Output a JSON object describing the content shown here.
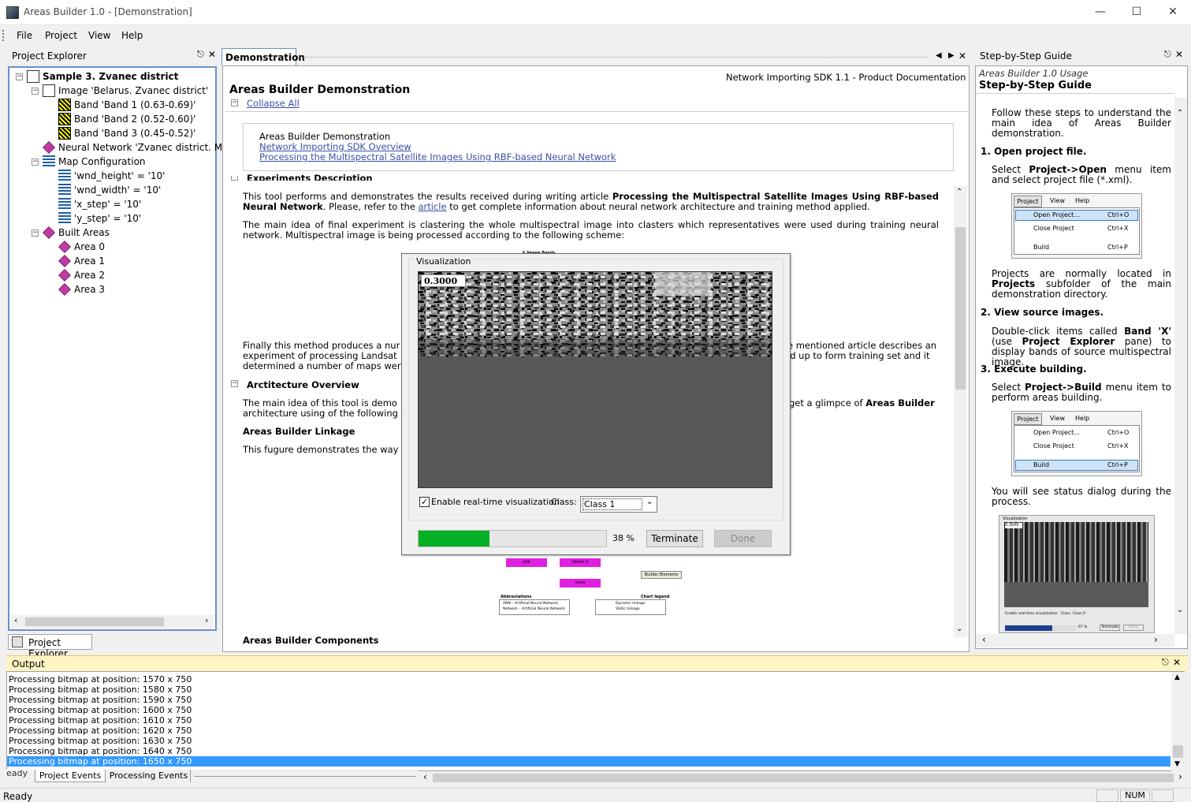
{
  "window": {
    "title": "Areas Builder 1.0 - [Demonstration]"
  },
  "menu": [
    "File",
    "Project",
    "View",
    "Help"
  ],
  "explorer": {
    "title": "Project Explorer",
    "tab_label": "Project Explorer",
    "items": [
      {
        "label": "Sample 3. Zvanec district",
        "icon": "project-icon"
      },
      {
        "label": "Image 'Belarus. Zvanec district'",
        "icon": "image-icon"
      },
      {
        "label": "Band 'Band 1 (0.63-0.69)'",
        "icon": "band-icon"
      },
      {
        "label": "Band 'Band 2 (0.52-0.60)'",
        "icon": "band-icon"
      },
      {
        "label": "Band 'Band 3 (0.45-0.52)'",
        "icon": "band-icon"
      },
      {
        "label": "Neural Network 'Zvanec district. Mult",
        "icon": "network-icon"
      },
      {
        "label": "Map Configuration",
        "icon": "map-icon"
      },
      {
        "label": "'wnd_height' = '10'",
        "icon": "variable-icon"
      },
      {
        "label": "'wnd_width' = '10'",
        "icon": "variable-icon"
      },
      {
        "label": "'x_step' = '10'",
        "icon": "variable-icon"
      },
      {
        "label": "'y_step' = '10'",
        "icon": "variable-icon"
      },
      {
        "label": "Built Areas",
        "icon": "areas-icon"
      },
      {
        "label": "Area 0",
        "icon": "area-icon"
      },
      {
        "label": "Area 1",
        "icon": "area-icon"
      },
      {
        "label": "Area 2",
        "icon": "area-icon"
      },
      {
        "label": "Area 3",
        "icon": "area-icon"
      }
    ]
  },
  "document": {
    "tab": "Demonstration",
    "header_right": "Network Importing SDK 1.1 - Product Documentation",
    "title": "Areas Builder Demonstration",
    "collapse": "Collapse All",
    "toc_title": "Areas Builder Demonstration",
    "toc_links": [
      "Network Importing SDK Overview",
      "Processing the Multispectral Satellite Images Using RBF-based Neural Network"
    ],
    "sec1": "Experiments Description",
    "p1a": "This tool performs and demonstrates the results received during writing article ",
    "p1b": "Processing the Multispectral Satellite Images Using RBF-based Neural Network",
    "p1c": ". Please, refer to the ",
    "p1link": "article",
    "p1d": " to get complete information about neural network architecture and training method applied.",
    "p2": "The main idea of final experiment is clastering the whole multispectral image into clasters which representatives were used during training neural network. Multispectral image is being processed according to the following scheme:",
    "p3l1a": "Finally this method produces a nur",
    "p3l1b": "e mentioned article describes an",
    "p3l2a": "experiment of processing Landsat",
    "p3l2b": "ld up to form training set and it",
    "p3l3": "determined a number of maps were",
    "sec2": "Arctitecture Overview",
    "p4l1a": "The main idea of this tool is demo",
    "p4l1b": "get a glimpce of ",
    "p4l1c": "Areas Builder",
    "p4l2": "architecture using of the following f",
    "sub1": "Areas Builder Linkage",
    "p5": "This fugure demonstrates the way t",
    "sub2": "Areas Builder Components"
  },
  "diagram": {
    "top_label": "k Image Bands",
    "boxes": [
      "stib",
      "hbsmt 3",
      "icons"
    ],
    "builder": "Builder Elements",
    "abbrev_title": "Abbreviations",
    "abbrev": [
      "ANN – Artificial Neural Network",
      "Network – Artificial Neural Network"
    ],
    "legend_title": "Chart legend",
    "legend": [
      "Dynamic linkage",
      "Static linkage"
    ]
  },
  "dialog": {
    "title": "Visualization",
    "value": "0.3000",
    "checkbox_label": "Enable real-time visualization",
    "checked": true,
    "class_label": "Class:",
    "class_value": "Class 1",
    "progress": 0.38,
    "progress_text": "38 %",
    "terminate": "Terminate",
    "done": "Done",
    "bar_color": "#06b025"
  },
  "guide": {
    "title": "Step-by-Step Guide",
    "subtitle": "Areas Builder 1.0 Usage",
    "heading": "Step-by-Step Guide",
    "intro": "Follow these steps to understand the main idea of Areas Builder demonstration.",
    "s1": "1. Open project file.",
    "s1a": "Select ",
    "s1b": "Project->Open",
    "s1c": " menu item and select project file (*.xml).",
    "menu1": {
      "tabs": [
        "Project",
        "View",
        "Help"
      ],
      "items": [
        [
          "Open Project...",
          "Ctrl+O"
        ],
        [
          "Close Project",
          "Ctrl+X"
        ],
        [
          "Build",
          "Ctrl+P"
        ]
      ]
    },
    "p2a": "Projects are normally located in ",
    "p2b": "Projects",
    "p2c": " subfolder of the main demonstration directory.",
    "s2": "2. View source images.",
    "s2a": "Double-click items called ",
    "s2b": "Band 'X'",
    "s2c": " (use ",
    "s2d": "Project Explorer",
    "s2e": " pane) to display bands of source multispectral image.",
    "s3": "3. Execute building.",
    "s3a": "Select ",
    "s3b": "Project->Build",
    "s3c": " menu item to perform areas building.",
    "p3": "You will see status dialog during the process.",
    "mini_vis": {
      "title": "Visualization",
      "value": "0.3000",
      "check": "Enable real-time visualization",
      "class_label": "Class:",
      "class": "Class 0",
      "pct": "67 %",
      "terminate": "Terminate",
      "done": "Done"
    }
  },
  "output": {
    "title": "Output",
    "lines": [
      "Processing bitmap at position: 1570 x 750",
      "Processing bitmap at position: 1580 x 750",
      "Processing bitmap at position: 1590 x 750",
      "Processing bitmap at position: 1600 x 750",
      "Processing bitmap at position: 1610 x 750",
      "Processing bitmap at position: 1620 x 750",
      "Processing bitmap at position: 1630 x 750",
      "Processing bitmap at position: 1640 x 750",
      "Processing bitmap at position: 1650 x 750"
    ],
    "tabs": [
      "Project Events",
      "Processing Events"
    ],
    "selected_color": "#3399ff"
  },
  "status": {
    "text": "Ready",
    "ghost": "eady",
    "num": "NUM"
  }
}
